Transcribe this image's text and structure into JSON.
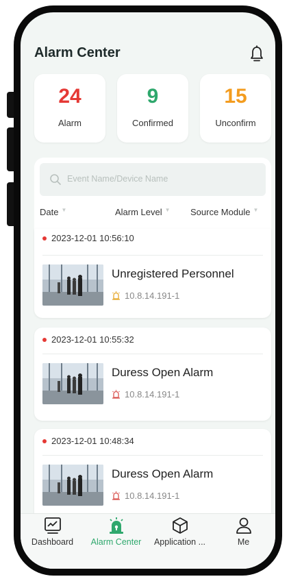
{
  "header": {
    "title": "Alarm Center",
    "bell_icon": "bell-icon"
  },
  "stats": [
    {
      "value": "24",
      "label": "Alarm",
      "color": "#e53935"
    },
    {
      "value": "9",
      "label": "Confirmed",
      "color": "#2fa86d"
    },
    {
      "value": "15",
      "label": "Unconfirm",
      "color": "#f39c1f"
    }
  ],
  "search": {
    "placeholder": "Event Name/Device Name",
    "icon": "search-icon"
  },
  "filters": {
    "date": "Date",
    "level": "Alarm Level",
    "source": "Source Module"
  },
  "events": [
    {
      "time": "2023-12-01 10:56:10",
      "name": "Unregistered Personnel",
      "source": "10.8.14.191-1",
      "icon_color": "#e6a72a"
    },
    {
      "time": "2023-12-01 10:55:32",
      "name": "Duress Open Alarm",
      "source": "10.8.14.191-1",
      "icon_color": "#d9534f"
    },
    {
      "time": "2023-12-01 10:48:34",
      "name": "Duress Open Alarm",
      "source": "10.8.14.191-1",
      "icon_color": "#d9534f"
    }
  ],
  "tabs": [
    {
      "label": "Dashboard",
      "icon": "dashboard-icon"
    },
    {
      "label": "Alarm Center",
      "icon": "alarm-light-icon",
      "active": true
    },
    {
      "label": "Application ...",
      "icon": "cube-icon"
    },
    {
      "label": "Me",
      "icon": "user-icon"
    }
  ],
  "colors": {
    "accent": "#2fa86d",
    "alarm_red": "#e53935",
    "warning_orange": "#f39c1f"
  }
}
